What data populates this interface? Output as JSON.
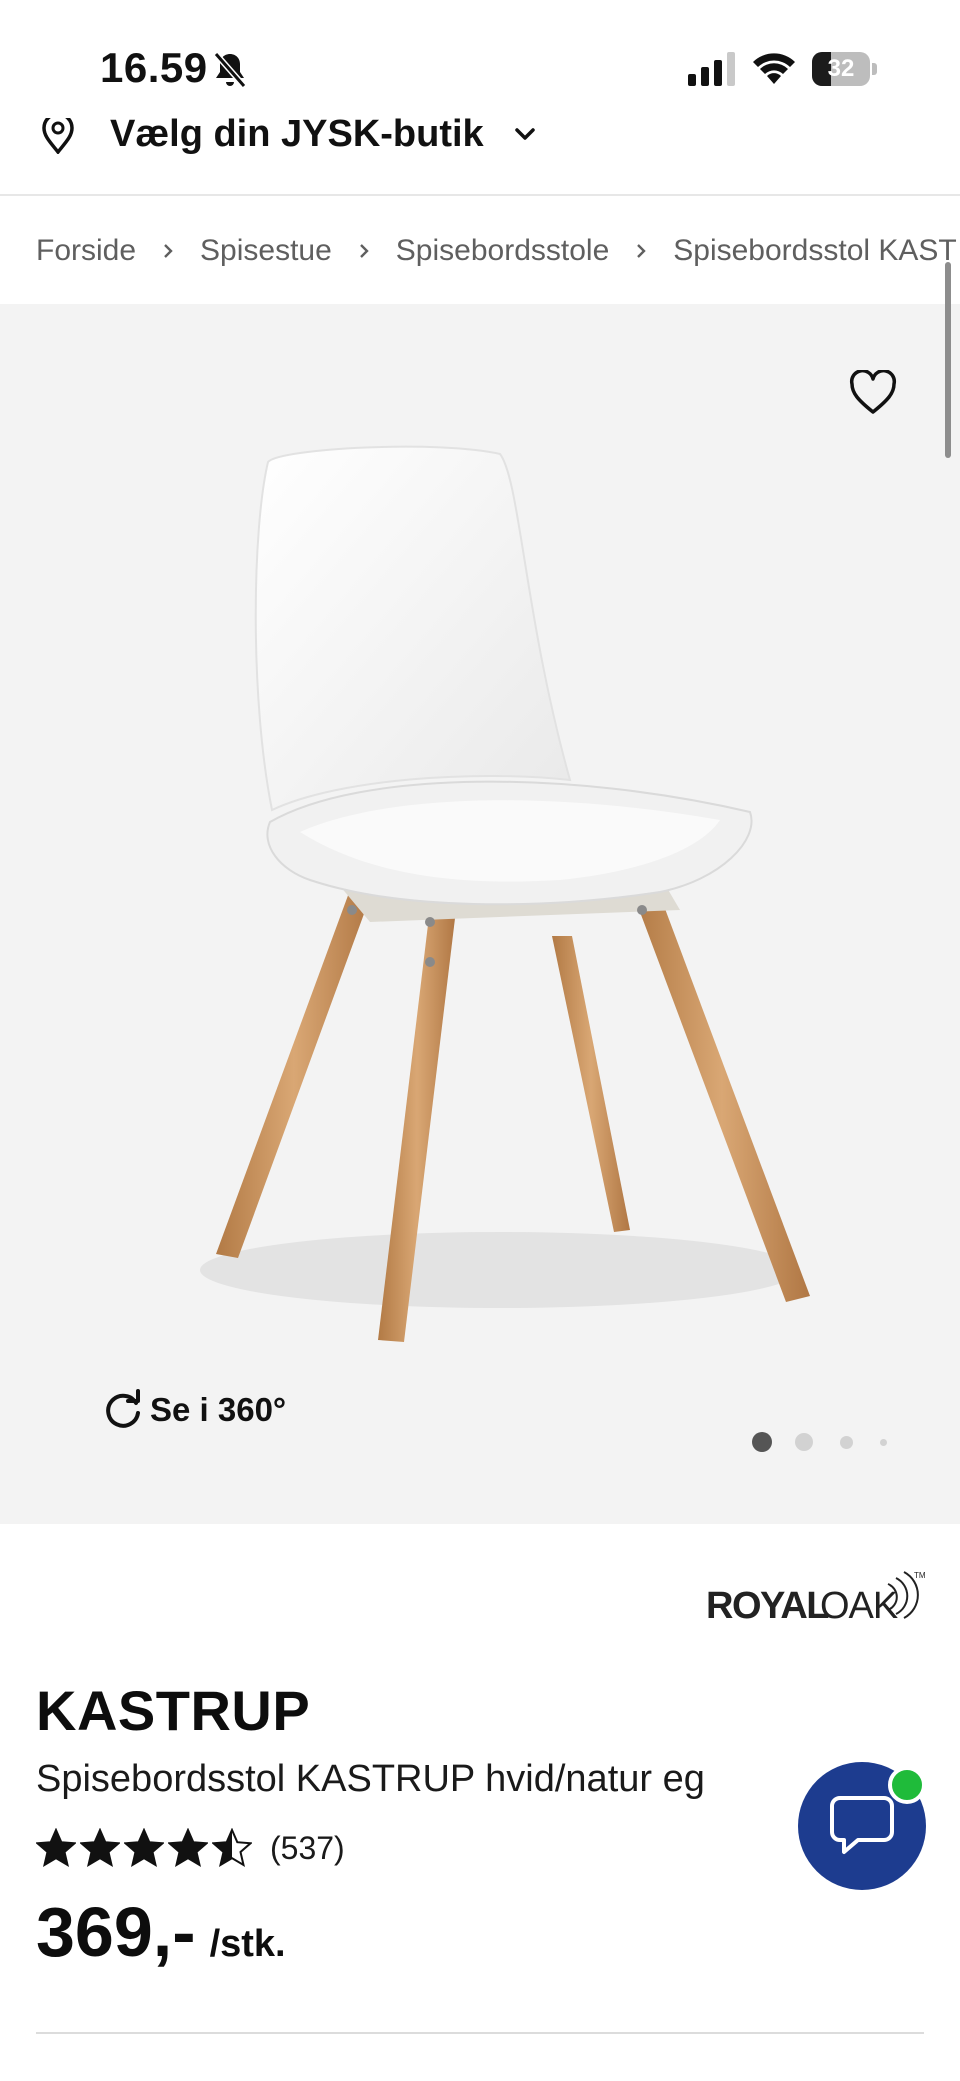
{
  "status_bar": {
    "time": "16.59",
    "battery": "32",
    "battery_level": 0.32
  },
  "store_selector": {
    "label": "Vælg din JYSK-butik"
  },
  "breadcrumb": [
    {
      "label": "Forside"
    },
    {
      "label": "Spisestue"
    },
    {
      "label": "Spisebordsstole"
    },
    {
      "label": "Spisebordsstol KAST"
    }
  ],
  "gallery": {
    "rotate_label": "Se i 360°",
    "page_count": 4,
    "active_page": 1
  },
  "product": {
    "brand_logo": "ROYALOAK",
    "name": "KASTRUP",
    "description": "Spisebordsstol KASTRUP hvid/natur eg",
    "rating": 4.5,
    "rating_max": 5,
    "rating_count": "(537)",
    "price": "369,-",
    "price_unit": "/stk."
  },
  "icons": {
    "bell": "bell-off-icon",
    "signal": "cellular-signal-icon",
    "wifi": "wifi-icon",
    "battery": "battery-icon",
    "pin": "location-pin-icon",
    "chevron": "chevron-down-icon",
    "separator": "chevron-right-icon",
    "favorite": "heart-icon",
    "rotate": "rotate-360-icon",
    "star": "star-icon",
    "chat": "chat-icon"
  },
  "colors": {
    "chat_fab": "#1d3c8f",
    "chat_online": "#1fbb3a",
    "gallery_bg": "#f3f3f3",
    "text": "#111111"
  }
}
